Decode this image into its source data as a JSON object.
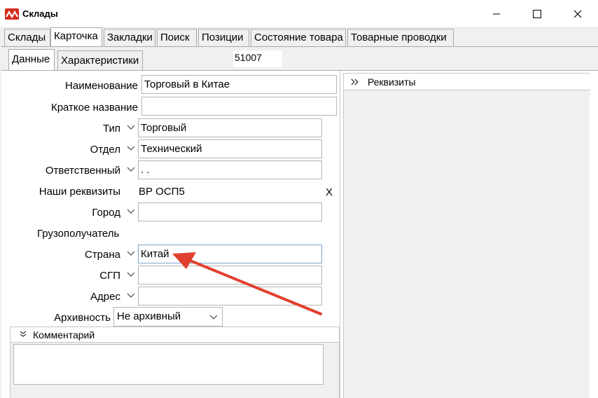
{
  "window": {
    "title": "Склады"
  },
  "main_tabs": [
    "Склады",
    "Карточка",
    "Закладки",
    "Поиск",
    "Позиции",
    "Состояние товара",
    "Товарные проводки"
  ],
  "sub_tabs": [
    "Данные",
    "Характеристики"
  ],
  "record_id": "51007",
  "form": {
    "name_label": "Наименование",
    "name_value": "Торговый в Китае",
    "short_label": "Краткое название",
    "short_value": "",
    "type_label": "Тип",
    "type_value": "Торговый",
    "dept_label": "Отдел",
    "dept_value": "Технический",
    "resp_label": "Ответственный",
    "resp_value": ". .",
    "req_label": "Наши реквизиты",
    "req_value": "ВР ОСП5",
    "req_clear": "X",
    "city_label": "Город",
    "city_value": "",
    "consignee_label": "Грузополучатель",
    "country_label": "Страна",
    "country_value": "Китай",
    "sgp_label": "СГП",
    "sgp_value": "",
    "address_label": "Адрес",
    "address_value": "",
    "archive_label": "Архивность",
    "archive_value": "Не архивный"
  },
  "comment_panel": {
    "title": "Комментарий",
    "value": ""
  },
  "requisites_panel": {
    "title": "Реквизиты"
  },
  "colors": {
    "accent": "#d52b1e",
    "annotation_arrow": "#e2402f"
  },
  "icons": [
    "app-logo-icon",
    "minimize-icon",
    "maximize-icon",
    "close-icon",
    "chevron-down-icon",
    "expand-right-icon",
    "collapse-down-icon",
    "annotation-arrow"
  ]
}
